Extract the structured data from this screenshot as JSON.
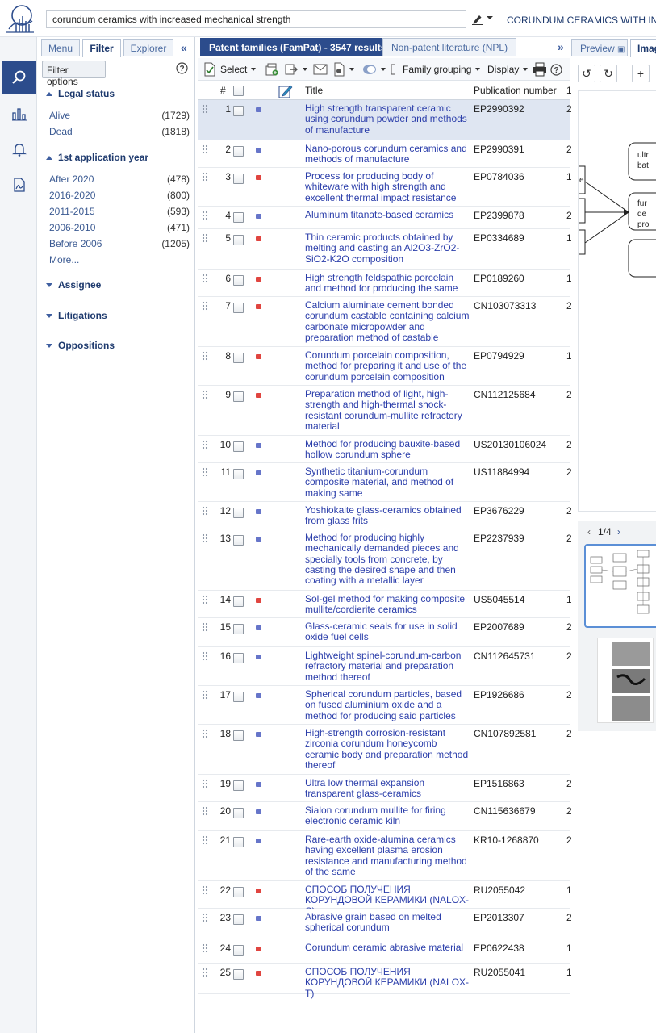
{
  "topbar": {
    "search_value": "corundum ceramics with increased mechanical strength",
    "query_title": "CORUNDUM CERAMICS WITH INCRE"
  },
  "rail": {
    "items": [
      {
        "icon": "search-icon",
        "active": true
      },
      {
        "icon": "bar-chart-icon",
        "active": false
      },
      {
        "icon": "bell-icon",
        "active": false
      },
      {
        "icon": "pdf-document-icon",
        "active": false
      }
    ]
  },
  "filter_panel": {
    "tabs": [
      "Menu",
      "Filter",
      "Explorer"
    ],
    "active_tab": "Filter",
    "filter_options_label": "Filter options",
    "legal_status": {
      "heading": "Legal status",
      "items": [
        {
          "label": "Alive",
          "count": "(1729)"
        },
        {
          "label": "Dead",
          "count": "(1818)"
        }
      ]
    },
    "app_year": {
      "heading": "1st application year",
      "items": [
        {
          "label": "After 2020",
          "count": "(478)"
        },
        {
          "label": "2016-2020",
          "count": "(800)"
        },
        {
          "label": "2011-2015",
          "count": "(593)"
        },
        {
          "label": "2006-2010",
          "count": "(471)"
        },
        {
          "label": "Before 2006",
          "count": "(1205)"
        }
      ],
      "more_label": "More..."
    },
    "assignee_heading": "Assignee",
    "litigations_heading": "Litigations",
    "oppositions_heading": "Oppositions"
  },
  "center": {
    "tabs": {
      "patents": "Patent families (FamPat) - 3547 results",
      "npl": "Non-patent literature (NPL)"
    },
    "toolbar": {
      "select_label": "Select",
      "family_grouping_label": "Family grouping",
      "display_label": "Display"
    },
    "columns": {
      "num": "#",
      "title": "Title",
      "pub": "Publication number"
    },
    "rows": [
      {
        "n": "1",
        "status": "alive",
        "title": "High strength transparent ceramic using corundum powder and methods of manufacture",
        "pub": "EP2990392",
        "extra": "2"
      },
      {
        "n": "2",
        "status": "alive",
        "title": "Nano-porous corundum ceramics and methods of manufacture",
        "pub": "EP2990391",
        "extra": "2"
      },
      {
        "n": "3",
        "status": "dead",
        "title": "Process for producing body of whiteware with high strength and excellent thermal impact resistance",
        "pub": "EP0784036",
        "extra": "1"
      },
      {
        "n": "4",
        "status": "alive",
        "title": "Aluminum titanate-based ceramics",
        "pub": "EP2399878",
        "extra": "2"
      },
      {
        "n": "5",
        "status": "dead",
        "title": "Thin ceramic products obtained by melting and casting an Al2O3-ZrO2-SiO2-K2O composition",
        "pub": "EP0334689",
        "extra": "1"
      },
      {
        "n": "6",
        "status": "dead",
        "title": "High strength feldspathic porcelain and method for producing the same",
        "pub": "EP0189260",
        "extra": "1"
      },
      {
        "n": "7",
        "status": "dead",
        "title": "Calcium aluminate cement bonded corundum castable containing calcium carbonate micropowder and preparation method of castable",
        "pub": "CN103073313",
        "extra": "2"
      },
      {
        "n": "8",
        "status": "dead",
        "title": "Corundum porcelain composition, method for preparing it and use of the corundum porcelain composition",
        "pub": "EP0794929",
        "extra": "1"
      },
      {
        "n": "9",
        "status": "dead",
        "title": "Preparation method of light, high-strength and high-thermal shock-resistant corundum-mullite refractory material",
        "pub": "CN112125684",
        "extra": "2"
      },
      {
        "n": "10",
        "status": "alive",
        "title": "Method for producing bauxite-based hollow corundum sphere",
        "pub": "US20130106024",
        "extra": "2"
      },
      {
        "n": "11",
        "status": "alive",
        "title": "Synthetic titanium-corundum composite material, and method of making same",
        "pub": "US11884994",
        "extra": "2"
      },
      {
        "n": "12",
        "status": "alive",
        "title": "Yoshiokaite glass-ceramics obtained from glass frits",
        "pub": "EP3676229",
        "extra": "2"
      },
      {
        "n": "13",
        "status": "alive",
        "title": "Method for producing highly mechanically demanded pieces and specially tools from concrete, by casting the desired shape and then coating with a metallic layer",
        "pub": "EP2237939",
        "extra": "2"
      },
      {
        "n": "14",
        "status": "dead",
        "title": "Sol-gel method for making composite mullite/cordierite ceramics",
        "pub": "US5045514",
        "extra": "1"
      },
      {
        "n": "15",
        "status": "alive",
        "title": "Glass-ceramic seals for use in solid oxide fuel cells",
        "pub": "EP2007689",
        "extra": "2"
      },
      {
        "n": "16",
        "status": "alive",
        "title": "Lightweight spinel-corundum-carbon refractory material and preparation method thereof",
        "pub": "CN112645731",
        "extra": "2"
      },
      {
        "n": "17",
        "status": "alive",
        "title": "Spherical corundum particles, based on fused aluminium oxide and a method for producing said particles",
        "pub": "EP1926686",
        "extra": "2"
      },
      {
        "n": "18",
        "status": "alive",
        "title": "High-strength corrosion-resistant zirconia corundum honeycomb ceramic body and preparation method thereof",
        "pub": "CN107892581",
        "extra": "2"
      },
      {
        "n": "19",
        "status": "alive",
        "title": "Ultra low thermal expansion transparent glass-ceramics",
        "pub": "EP1516863",
        "extra": "2"
      },
      {
        "n": "20",
        "status": "alive",
        "title": "Sialon corundum mullite for firing electronic ceramic kiln",
        "pub": "CN115636679",
        "extra": "2"
      },
      {
        "n": "21",
        "status": "alive",
        "title": "Rare-earth oxide-alumina ceramics having excellent plasma erosion resistance and manufacturing method of the same",
        "pub": "KR10-1268870",
        "extra": "2"
      },
      {
        "n": "22",
        "status": "dead",
        "title": "СПОСОБ ПОЛУЧЕНИЯ КОРУНДОВОЙ КЕРАМИКИ (NALOX-C)",
        "pub": "RU2055042",
        "extra": "1"
      },
      {
        "n": "23",
        "status": "alive",
        "title": "Abrasive grain based on melted spherical corundum",
        "pub": "EP2013307",
        "extra": "2"
      },
      {
        "n": "24",
        "status": "dead",
        "title": "Corundum ceramic abrasive material",
        "pub": "EP0622438",
        "extra": "1"
      },
      {
        "n": "25",
        "status": "dead",
        "title": "СПОСОБ ПОЛУЧЕНИЯ КОРУНДОВОЙ КЕРАМИКИ (NALOX-T)",
        "pub": "RU2055041",
        "extra": "1"
      }
    ]
  },
  "right_panel": {
    "tabs": {
      "preview": "Preview",
      "images": "Imag"
    },
    "pager": "1/4",
    "drawing_labels": [
      "ultr",
      "bat",
      "e",
      "fur",
      "de",
      "pro"
    ],
    "status_colors": {
      "alive": "#6675c9",
      "dead": "#e04540",
      "accent": "#2c4c8c"
    }
  }
}
